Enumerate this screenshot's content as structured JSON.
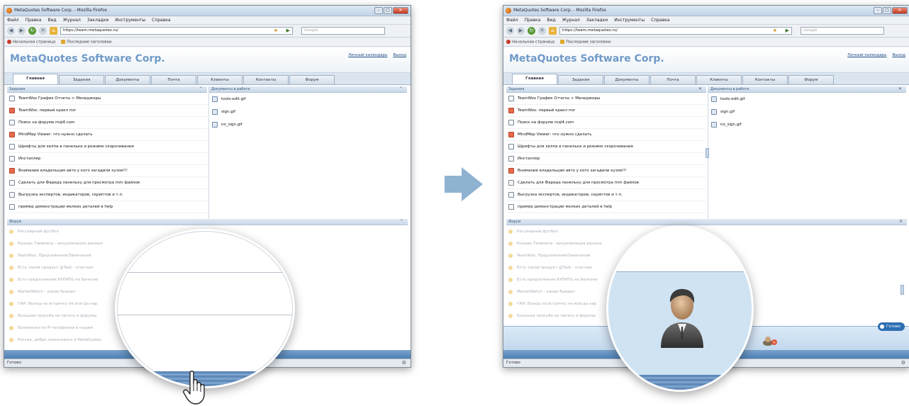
{
  "browser": {
    "title": "MetaQuotes Software Corp. - Mozilla Firefox",
    "menu": [
      "Файл",
      "Правка",
      "Вид",
      "Журнал",
      "Закладки",
      "Инструменты",
      "Справка"
    ],
    "url": "https://team.metaquotes.ru/",
    "search_placeholder": "Google",
    "bookmarks": [
      "Начальная страница",
      "Последние заголовки"
    ],
    "status": "Готово"
  },
  "app": {
    "title": "MetaQuotes Software Corp.",
    "links": [
      "Личный календарь",
      "Выход"
    ],
    "tabs": [
      "Главная",
      "Задания",
      "Документы",
      "Почта",
      "Клиенты",
      "Контакты",
      "Форум"
    ]
  },
  "tasks_pane": {
    "title": "Задания",
    "items": [
      "TeamWox График Отчеты > Менеджеры",
      "TeamWox: первый кракл пог",
      "Поиск на форуме mql4.com",
      "MindMap Viewer: что нужно сделать",
      "Шрифты для хелпа в панельке и режиме скорочивания",
      "Инсталлер",
      "Внимание владельцам авто у кого загадили кузов!!!",
      "Сделать для Фарида панельку для просмотра mm файлов",
      "Выгрузка экспертов, индикаторов, скриптов и т.п.",
      "пример демонстрации мелких деталей в help"
    ]
  },
  "docs_pane": {
    "title": "Документы в работе",
    "items": [
      "tools-edit.gif",
      "sign.gif",
      "no_sign.gif"
    ]
  },
  "forum_pane": {
    "title": "Форум",
    "items": [
      "Регулярный футбол",
      "Козырь Тимвокса - визуализация данных",
      "TeamWox. Предложения/Замечания",
      "Есть такой продукт @Task - платная",
      "Есть предложение КУПИТЬ на балконе",
      "MarketWatch - какие бывают",
      "ГАИ: Выход на встречку не всегда нар",
      "Большая просьба не писать в форумы",
      "Возможности IP-телефонии в нашем",
      "Россия, добро пожаловать в MetaQuotes"
    ]
  },
  "right_window": {
    "ready_button": "Готово"
  },
  "colors": {
    "accent": "#6f9ac8",
    "arrow": "#8fb2d0",
    "band": "#5e88b8",
    "lens_fill": "#cfe3f3"
  }
}
